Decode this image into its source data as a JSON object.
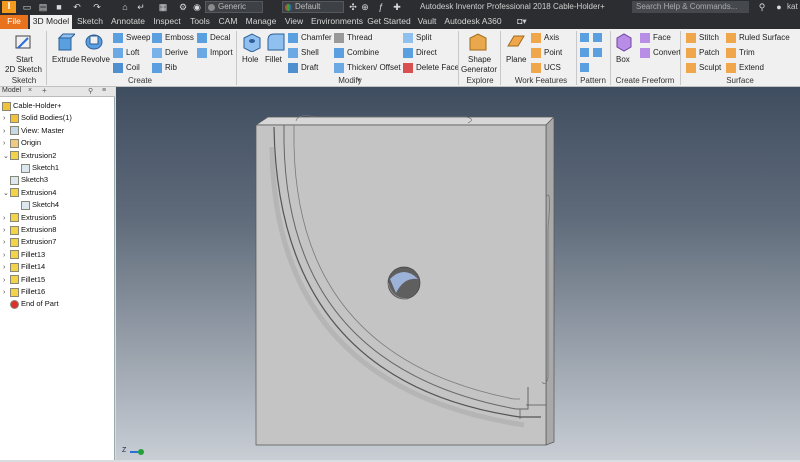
{
  "titlebar": {
    "title": "Autodesk Inventor Professional 2018    Cable-Holder+",
    "material": "Generic",
    "appearance": "Default",
    "search_placeholder": "Search Help & Commands...",
    "user": "kat"
  },
  "tabs": [
    "File",
    "3D Model",
    "Sketch",
    "Annotate",
    "Inspect",
    "Tools",
    "CAM",
    "Manage",
    "View",
    "Environments",
    "Get Started",
    "Vault",
    "Autodesk A360"
  ],
  "ribbon": {
    "sketch": {
      "start_sketch": "Start",
      "start_sketch_2": "2D Sketch",
      "group": "Sketch"
    },
    "create": {
      "extrude": "Extrude",
      "revolve": "Revolve",
      "sweep": "Sweep",
      "emboss": "Emboss",
      "decal": "Decal",
      "loft": "Loft",
      "derive": "Derive",
      "import": "Import",
      "coil": "Coil",
      "rib": "Rib",
      "group": "Create"
    },
    "modify": {
      "hole": "Hole",
      "fillet": "Fillet",
      "chamfer": "Chamfer",
      "thread": "Thread",
      "split": "Split",
      "shell": "Shell",
      "combine": "Combine",
      "direct": "Direct",
      "draft": "Draft",
      "thicken": "Thicken/ Offset",
      "delete_face": "Delete Face",
      "group": "Modify"
    },
    "explore": {
      "shape_gen_1": "Shape",
      "shape_gen_2": "Generator",
      "group": "Explore"
    },
    "work": {
      "plane": "Plane",
      "axis": "Axis",
      "point": "Point",
      "ucs": "UCS",
      "group": "Work Features"
    },
    "pattern": {
      "group": "Pattern"
    },
    "freeform": {
      "box": "Box",
      "face": "Face",
      "convert": "Convert",
      "group": "Create Freeform"
    },
    "surface": {
      "stitch": "Stitch",
      "ruled": "Ruled Surface",
      "patch": "Patch",
      "trim": "Trim",
      "sculpt": "Sculpt",
      "extend": "Extend",
      "group": "Surface"
    }
  },
  "browser": {
    "tab": "Model",
    "items": [
      {
        "label": "Cable-Holder+",
        "level": 0
      },
      {
        "label": "Solid Bodies(1)",
        "level": 1
      },
      {
        "label": "View: Master",
        "level": 1
      },
      {
        "label": "Origin",
        "level": 1
      },
      {
        "label": "Extrusion2",
        "level": 1
      },
      {
        "label": "Sketch1",
        "level": 2
      },
      {
        "label": "Sketch3",
        "level": 1
      },
      {
        "label": "Extrusion4",
        "level": 1
      },
      {
        "label": "Sketch4",
        "level": 2
      },
      {
        "label": "Extrusion5",
        "level": 1
      },
      {
        "label": "Extrusion8",
        "level": 1
      },
      {
        "label": "Extrusion7",
        "level": 1
      },
      {
        "label": "Fillet13",
        "level": 1
      },
      {
        "label": "Fillet14",
        "level": 1
      },
      {
        "label": "Fillet15",
        "level": 1
      },
      {
        "label": "Fillet16",
        "level": 1
      },
      {
        "label": "End of Part",
        "level": 1
      }
    ]
  },
  "viewport": {
    "axis_label": "Z"
  }
}
